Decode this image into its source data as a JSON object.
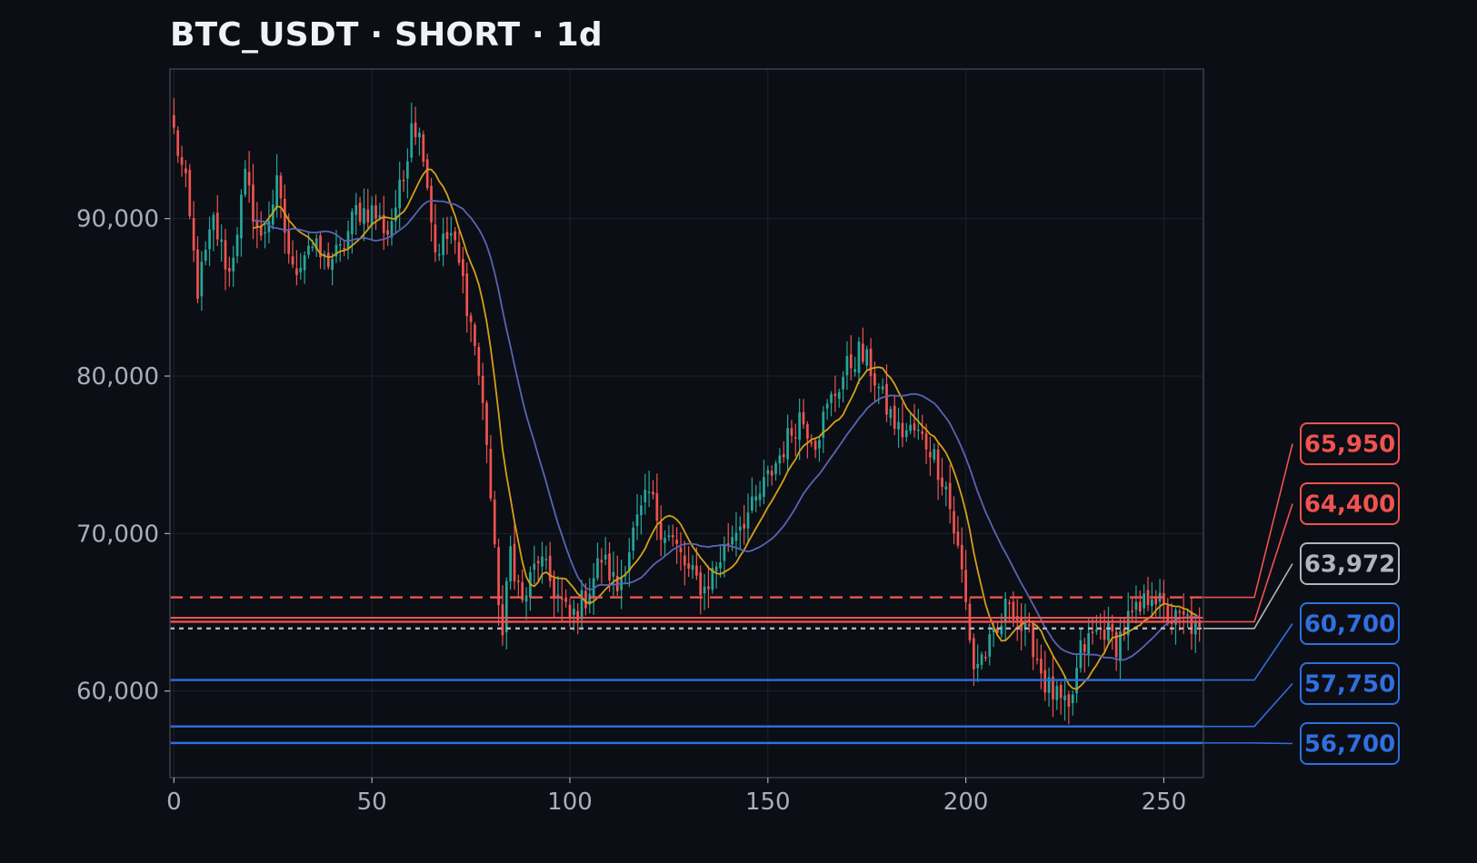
{
  "header": {
    "title": "BTC_USDT · SHORT · 1d"
  },
  "chart_data": {
    "type": "candlestick",
    "title": "BTC_USDT · SHORT · 1d",
    "xlim": [
      -1,
      260
    ],
    "ylim": [
      54500,
      99500
    ],
    "x_ticks": [
      0,
      50,
      100,
      150,
      200,
      250
    ],
    "x_tick_labels": [
      "0",
      "50",
      "100",
      "150",
      "200",
      "250"
    ],
    "y_ticks": [
      60000,
      70000,
      80000,
      90000
    ],
    "y_tick_labels": [
      "60,000",
      "70,000",
      "80,000",
      "90,000"
    ],
    "grid": true,
    "colors": {
      "background": "#0b0e14",
      "panel_border": "#3a3f4a",
      "grid": "#1c212b",
      "tick_text": "#a9afba",
      "up_candle": "#26a69a",
      "down_candle": "#ef5350",
      "ma_fast": "#d4a017",
      "ma_slow": "#5a64b4",
      "red_level": "#ef5350",
      "gray_level": "#b0b4bc",
      "blue_level": "#2f6fe0"
    },
    "close_anchors": [
      [
        0,
        95500
      ],
      [
        3,
        92000
      ],
      [
        6,
        85500
      ],
      [
        10,
        89800
      ],
      [
        14,
        86500
      ],
      [
        18,
        92500
      ],
      [
        22,
        88500
      ],
      [
        26,
        92000
      ],
      [
        30,
        86500
      ],
      [
        34,
        88500
      ],
      [
        38,
        87300
      ],
      [
        42,
        87800
      ],
      [
        46,
        90500
      ],
      [
        50,
        90500
      ],
      [
        54,
        89200
      ],
      [
        58,
        92500
      ],
      [
        60,
        96500
      ],
      [
        63,
        94500
      ],
      [
        66,
        88000
      ],
      [
        70,
        89000
      ],
      [
        73,
        86000
      ],
      [
        76,
        82000
      ],
      [
        79,
        76000
      ],
      [
        81,
        68500
      ],
      [
        83,
        63500
      ],
      [
        85,
        69000
      ],
      [
        88,
        65500
      ],
      [
        92,
        68500
      ],
      [
        96,
        66500
      ],
      [
        100,
        64500
      ],
      [
        104,
        66000
      ],
      [
        108,
        68500
      ],
      [
        112,
        66500
      ],
      [
        116,
        70000
      ],
      [
        120,
        72500
      ],
      [
        123,
        70500
      ],
      [
        126,
        69500
      ],
      [
        130,
        67500
      ],
      [
        134,
        66500
      ],
      [
        138,
        68500
      ],
      [
        142,
        70500
      ],
      [
        146,
        71500
      ],
      [
        150,
        73500
      ],
      [
        154,
        75500
      ],
      [
        158,
        77500
      ],
      [
        162,
        76000
      ],
      [
        166,
        78500
      ],
      [
        170,
        80500
      ],
      [
        173,
        81500
      ],
      [
        176,
        80500
      ],
      [
        179,
        78500
      ],
      [
        183,
        76500
      ],
      [
        187,
        76500
      ],
      [
        191,
        75500
      ],
      [
        195,
        73000
      ],
      [
        199,
        67500
      ],
      [
        202,
        61500
      ],
      [
        205,
        62500
      ],
      [
        208,
        63500
      ],
      [
        211,
        66000
      ],
      [
        214,
        64000
      ],
      [
        217,
        63000
      ],
      [
        220,
        60500
      ],
      [
        223,
        59500
      ],
      [
        226,
        58500
      ],
      [
        229,
        62500
      ],
      [
        232,
        63500
      ],
      [
        235,
        64000
      ],
      [
        238,
        63000
      ],
      [
        241,
        64500
      ],
      [
        244,
        65000
      ],
      [
        247,
        66500
      ],
      [
        250,
        65000
      ],
      [
        253,
        64500
      ],
      [
        256,
        64500
      ],
      [
        259,
        63500
      ]
    ],
    "levels": [
      {
        "value": 65950,
        "label": "65,950",
        "color": "#ef5350",
        "style": "dashed"
      },
      {
        "value": 64400,
        "label": "64,400",
        "color": "#ef5350",
        "style": "solid"
      },
      {
        "value": 63972,
        "label": "63,972",
        "color": "#b0b4bc",
        "style": "dotted"
      },
      {
        "value": 60700,
        "label": "60,700",
        "color": "#2f6fe0",
        "style": "solid"
      },
      {
        "value": 57750,
        "label": "57,750",
        "color": "#2f6fe0",
        "style": "solid"
      },
      {
        "value": 56700,
        "label": "56,700",
        "color": "#2f6fe0",
        "style": "solid"
      }
    ],
    "extra_lines": [
      {
        "value": 64650,
        "color": "#ef5350",
        "style": "solid"
      }
    ],
    "moving_averages": [
      {
        "period": 10,
        "color": "#d4a017"
      },
      {
        "period": 24,
        "color": "#5a64b4"
      }
    ]
  }
}
